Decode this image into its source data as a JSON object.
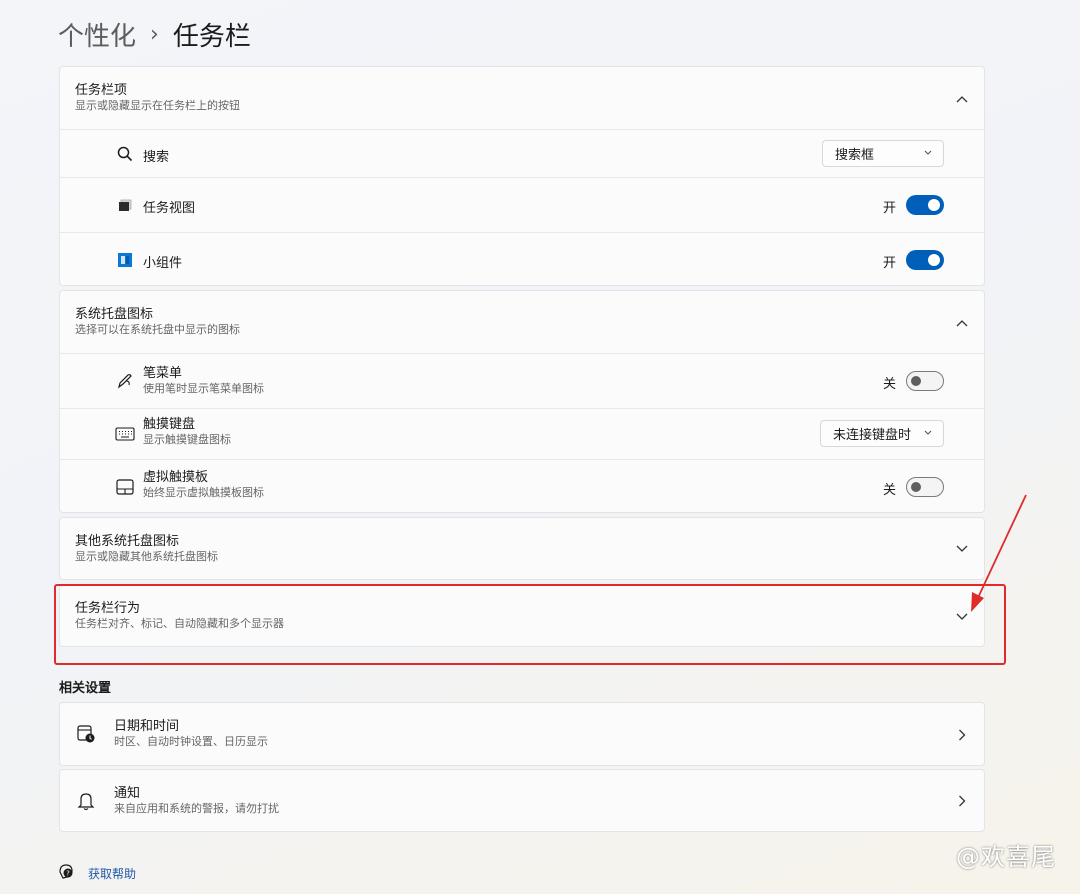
{
  "header": {
    "breadcrumb_parent": "个性化",
    "separator": "›",
    "title": "任务栏"
  },
  "taskbar_items": {
    "title": "任务栏项",
    "subtitle": "显示或隐藏显示在任务栏上的按钮",
    "rows": [
      {
        "label": "搜索",
        "icon": "search-icon",
        "control": "dropdown",
        "value": "搜索框"
      },
      {
        "label": "任务视图",
        "icon": "task-view-icon",
        "control": "toggle",
        "state_label": "开",
        "on": true
      },
      {
        "label": "小组件",
        "icon": "widgets-icon",
        "control": "toggle",
        "state_label": "开",
        "on": true
      }
    ]
  },
  "system_tray": {
    "title": "系统托盘图标",
    "subtitle": "选择可以在系统托盘中显示的图标",
    "rows": [
      {
        "label": "笔菜单",
        "sub": "使用笔时显示笔菜单图标",
        "icon": "pen-icon",
        "control": "toggle",
        "state_label": "关",
        "on": false
      },
      {
        "label": "触摸键盘",
        "sub": "显示触摸键盘图标",
        "icon": "keyboard-icon",
        "control": "dropdown",
        "value": "未连接键盘时"
      },
      {
        "label": "虚拟触摸板",
        "sub": "始终显示虚拟触摸板图标",
        "icon": "touchpad-icon",
        "control": "toggle",
        "state_label": "关",
        "on": false
      }
    ]
  },
  "other_tray": {
    "title": "其他系统托盘图标",
    "subtitle": "显示或隐藏其他系统托盘图标"
  },
  "taskbar_behavior": {
    "title": "任务栏行为",
    "subtitle": "任务栏对齐、标记、自动隐藏和多个显示器"
  },
  "related": {
    "section_title": "相关设置",
    "items": [
      {
        "title": "日期和时间",
        "subtitle": "时区、自动时钟设置、日历显示",
        "icon": "calendar-clock-icon"
      },
      {
        "title": "通知",
        "subtitle": "来自应用和系统的警报，请勿打扰",
        "icon": "bell-icon"
      }
    ]
  },
  "help": {
    "label": "获取帮助",
    "icon": "help-icon"
  },
  "watermark": "@欢喜尾",
  "colors": {
    "accent": "#005fb8",
    "highlight_box": "#e02b2b",
    "arrow": "#e02b2b"
  }
}
